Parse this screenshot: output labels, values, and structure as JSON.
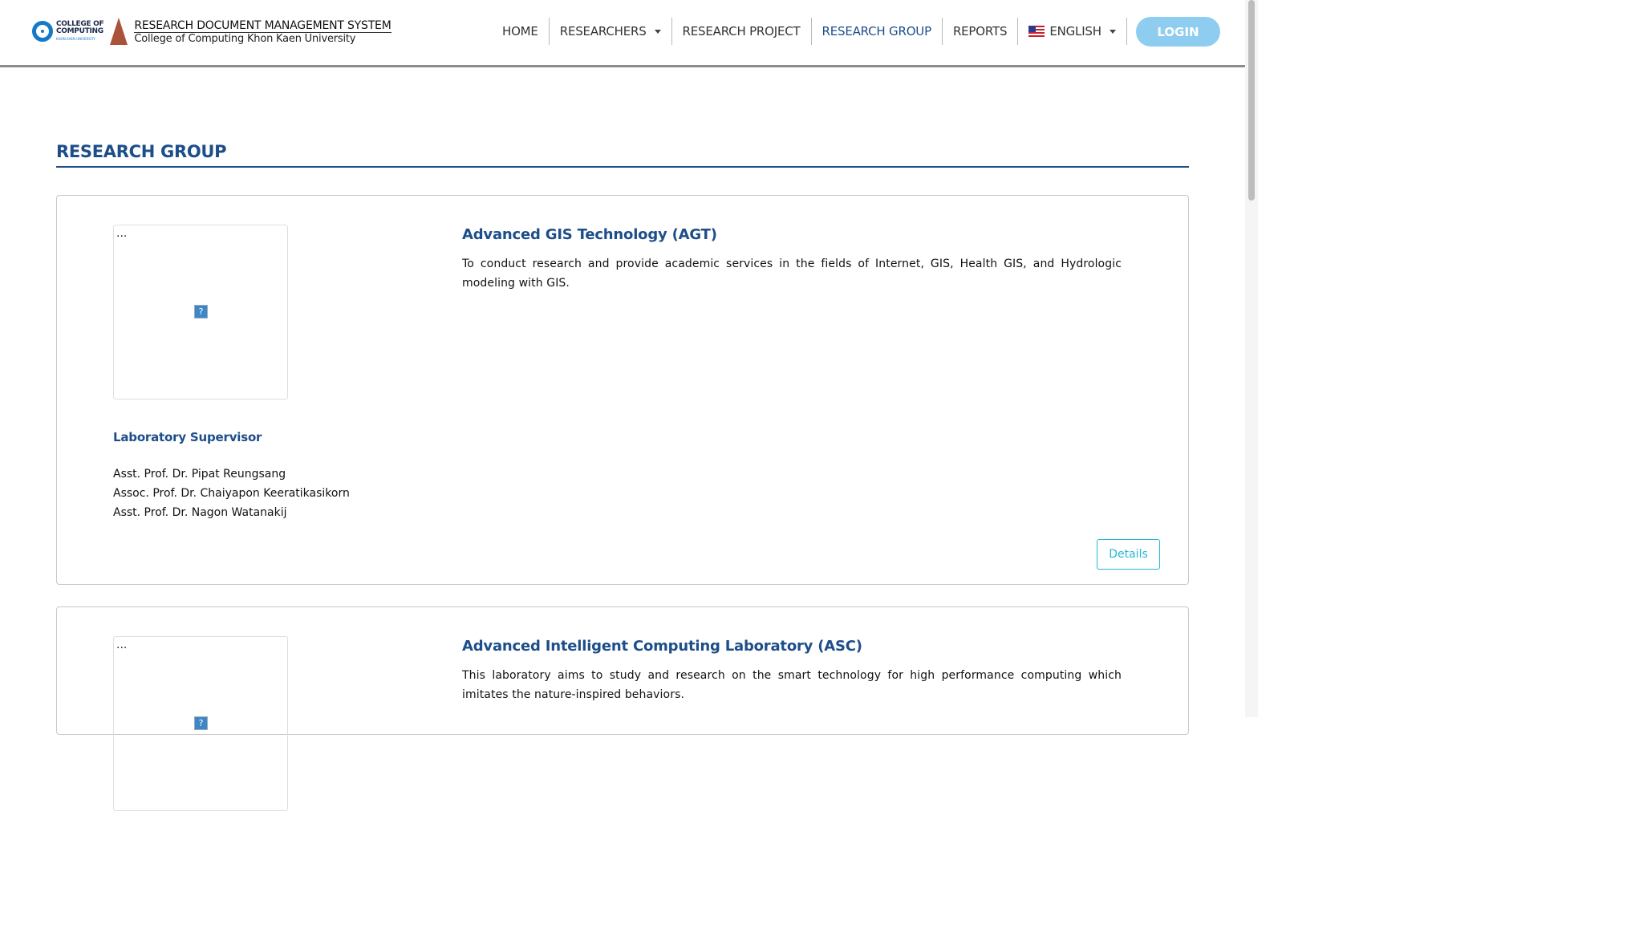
{
  "brand": {
    "college_logo_line1": "COLLEGE OF",
    "college_logo_line2": "COMPUTING",
    "college_logo_line3": "KHON KAEN UNIVERSITY",
    "title": "RESEARCH DOCUMENT MANAGEMENT SYSTEM",
    "subtitle": "College of Computing Khon Kaen University"
  },
  "nav": {
    "items": [
      {
        "label": "HOME"
      },
      {
        "label": "RESEARCHERS"
      },
      {
        "label": "RESEARCH PROJECT"
      },
      {
        "label": "RESEARCH GROUP",
        "active": true
      },
      {
        "label": "REPORTS"
      }
    ],
    "language": "ENGLISH",
    "login": "LOGIN"
  },
  "page": {
    "title": "RESEARCH GROUP"
  },
  "groups": [
    {
      "image_alt": "...",
      "name": "Advanced GIS Technology (AGT)",
      "description": "To conduct research and provide academic services in the fields of Internet, GIS, Health GIS, and Hydrologic modeling with GIS.",
      "supervisor_label": "Laboratory Supervisor",
      "supervisors": [
        "Asst. Prof. Dr. Pipat Reungsang",
        "Assoc. Prof. Dr. Chaiyapon Keeratikasikorn",
        "Asst. Prof. Dr. Nagon Watanakij"
      ],
      "details_label": "Details"
    },
    {
      "image_alt": "...",
      "name": "Advanced Intelligent Computing Laboratory (ASC)",
      "description": "This laboratory aims to study and research on the smart technology for high performance computing which imitates the nature-inspired behaviors."
    }
  ],
  "colors": {
    "primary": "#1d4e89",
    "login_bg": "#8fcdf0",
    "details_border": "#22b8d6"
  }
}
